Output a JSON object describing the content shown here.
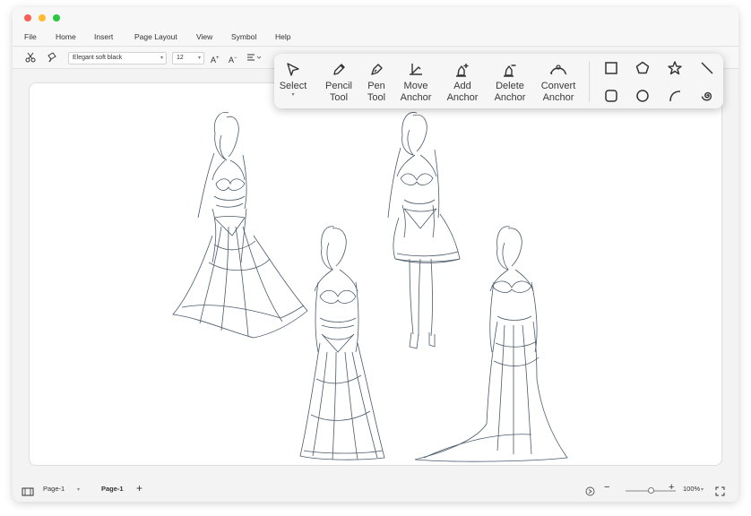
{
  "window": {
    "traffic_lights": {
      "close": "#ff5f57",
      "minimize": "#febc2e",
      "zoom": "#28c840"
    }
  },
  "menu": {
    "items": [
      "File",
      "Home",
      "Insert",
      "Page Layout",
      "View",
      "Symbol",
      "Help"
    ]
  },
  "toolbar": {
    "font_family": "Elegant soft black",
    "font_size": "12",
    "icons": [
      "cut-icon",
      "format-painter-icon",
      "increase-font-icon",
      "decrease-font-icon",
      "align-icon"
    ]
  },
  "tool_popup": {
    "tools": [
      {
        "label_line1": "Select",
        "label_line2": "",
        "icon": "pointer-icon"
      },
      {
        "label_line1": "Pencil",
        "label_line2": "Tool",
        "icon": "pencil-icon"
      },
      {
        "label_line1": "Pen",
        "label_line2": "Tool",
        "icon": "pen-icon"
      },
      {
        "label_line1": "Move",
        "label_line2": "Anchor",
        "icon": "move-anchor-icon"
      },
      {
        "label_line1": "Add",
        "label_line2": "Anchor",
        "icon": "add-anchor-icon"
      },
      {
        "label_line1": "Delete",
        "label_line2": "Anchor",
        "icon": "delete-anchor-icon"
      },
      {
        "label_line1": "Convert",
        "label_line2": "Anchor",
        "icon": "convert-anchor-icon"
      }
    ],
    "shapes": [
      "square-icon",
      "pentagon-icon",
      "star-icon",
      "line-icon",
      "rounded-square-icon",
      "circle-icon",
      "arc-icon",
      "spiral-icon"
    ]
  },
  "canvas": {
    "content": "fashion-sketch-figures",
    "stroke_color": "#4a5a6a"
  },
  "statusbar": {
    "page_selector": "Page-1",
    "active_page_tab": "Page-1",
    "zoom_label": "100%",
    "zoom_fraction": 0.5
  }
}
